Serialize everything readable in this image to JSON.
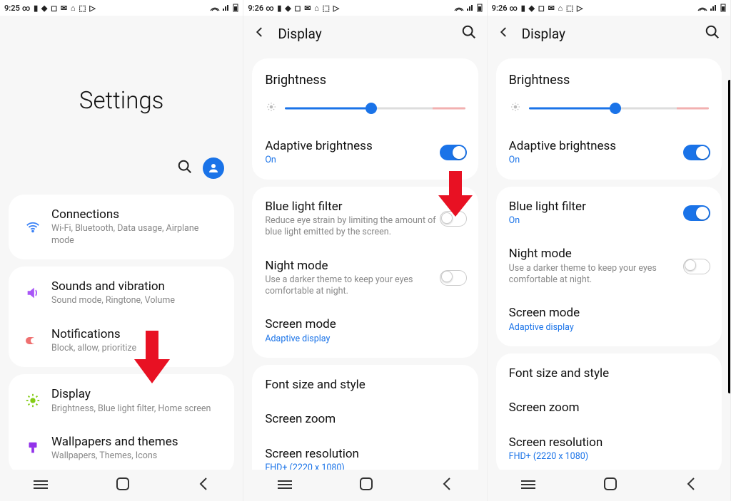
{
  "panel1": {
    "status_time": "9:25",
    "page_title": "Settings",
    "items": [
      {
        "title": "Connections",
        "sub": "Wi-Fi, Bluetooth, Data usage, Airplane mode"
      },
      {
        "title": "Sounds and vibration",
        "sub": "Sound mode, Ringtone, Volume"
      },
      {
        "title": "Notifications",
        "sub": "Block, allow, prioritize"
      },
      {
        "title": "Display",
        "sub": "Brightness, Blue light filter, Home screen"
      },
      {
        "title": "Wallpapers and themes",
        "sub": "Wallpapers, Themes, Icons"
      }
    ]
  },
  "panel2": {
    "status_time": "9:26",
    "page_title": "Display",
    "brightness_label": "Brightness",
    "brightness_pct": 48,
    "adaptive": {
      "title": "Adaptive brightness",
      "state": "On",
      "on": true
    },
    "bluelight": {
      "title": "Blue light filter",
      "sub": "Reduce eye strain by limiting the amount of blue light emitted by the screen.",
      "on": false
    },
    "nightmode": {
      "title": "Night mode",
      "sub": "Use a darker theme to keep your eyes comfortable at night.",
      "on": false
    },
    "screenmode": {
      "title": "Screen mode",
      "value": "Adaptive display"
    },
    "fontsize": "Font size and style",
    "screenzoom": "Screen zoom",
    "resolution": {
      "title": "Screen resolution",
      "value": "FHD+ (2220 x 1080)"
    }
  },
  "panel3": {
    "status_time": "9:26",
    "page_title": "Display",
    "brightness_label": "Brightness",
    "brightness_pct": 48,
    "adaptive": {
      "title": "Adaptive brightness",
      "state": "On",
      "on": true
    },
    "bluelight": {
      "title": "Blue light filter",
      "state": "On",
      "on": true
    },
    "nightmode": {
      "title": "Night mode",
      "sub": "Use a darker theme to keep your eyes comfortable at night.",
      "on": false
    },
    "screenmode": {
      "title": "Screen mode",
      "value": "Adaptive display"
    },
    "fontsize": "Font size and style",
    "screenzoom": "Screen zoom",
    "resolution": {
      "title": "Screen resolution",
      "value": "FHD+ (2220 x 1080)"
    }
  }
}
